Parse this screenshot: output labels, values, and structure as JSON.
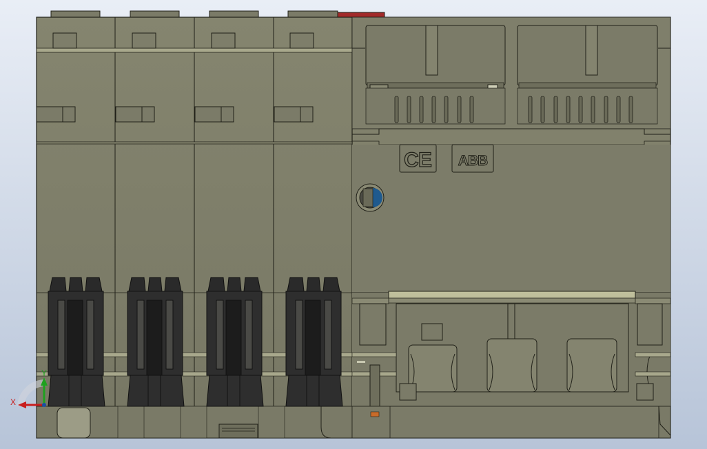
{
  "brand": {
    "ce_mark": "CE",
    "logo": "ABB"
  },
  "triad": {
    "x_label": "X",
    "y_label": "Y"
  },
  "colors": {
    "background_top": "#e9eef6",
    "background_bottom": "#b7c4d8",
    "body": "#7b7b68",
    "body_light": "#868673",
    "body_dark": "#6e6e5c",
    "edge": "#202018",
    "band": "#bfbf9c",
    "terminal": "#2e2e2e",
    "terminal_dark": "#1c1c1c",
    "red_tab": "#a22a2a",
    "indicator_blue": "#1f5a8e",
    "axis_y": "#1ea11e",
    "axis_x": "#c81e1e",
    "accent_orange": "#c86b2a"
  },
  "icons": [
    "ce-mark-icon",
    "abb-logo-icon",
    "status-indicator-icon",
    "coordinate-triad-icon"
  ]
}
